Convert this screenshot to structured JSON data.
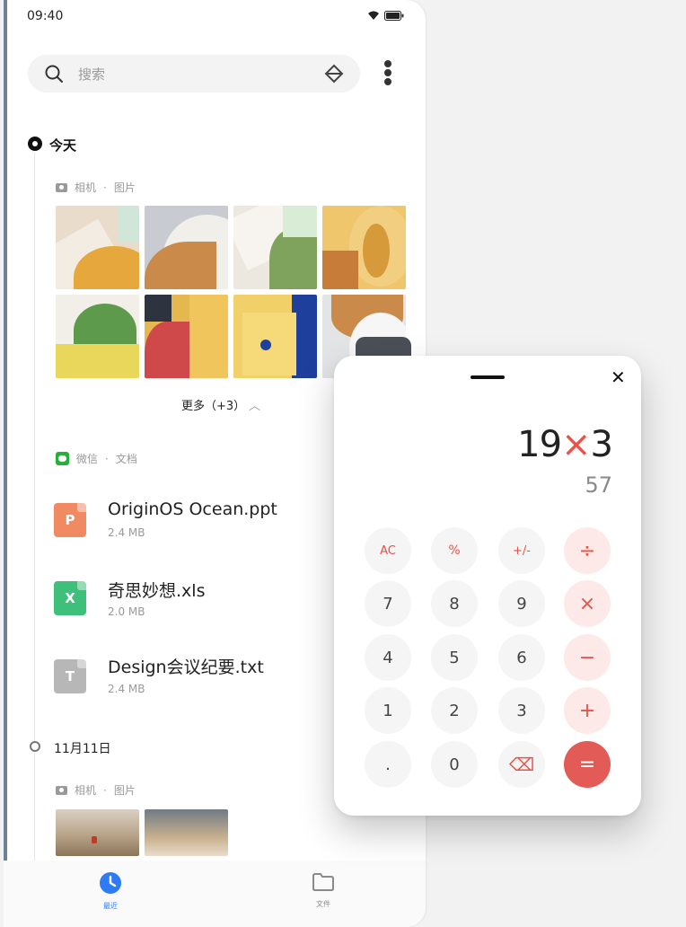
{
  "status": {
    "time": "09:40"
  },
  "search": {
    "placeholder": "搜索"
  },
  "today": {
    "title": "今天",
    "photos_source": {
      "app": "相机",
      "type": "图片"
    },
    "more": "更多（+3）",
    "docs_source": {
      "app": "微信",
      "type": "文档"
    },
    "files": [
      {
        "name": "OriginOS  Ocean.ppt",
        "size": "2.4 MB",
        "icon_letter": "P",
        "color": "#f08a63"
      },
      {
        "name": "奇思妙想.xls",
        "size": "2.0 MB",
        "icon_letter": "X",
        "color": "#3ec07a"
      },
      {
        "name": "Design会议纪要.txt",
        "size": "2.4 MB",
        "icon_letter": "T",
        "color": "#b7b7b7"
      }
    ]
  },
  "section2": {
    "title": "11月11日",
    "photos_source": {
      "app": "相机",
      "type": "图片"
    }
  },
  "tabs": [
    {
      "label": "最近",
      "active": true
    },
    {
      "label": "文件",
      "active": false
    }
  ],
  "calculator": {
    "expression_left": "19",
    "expression_op": "×",
    "expression_right": "3",
    "result": "57",
    "keys": [
      [
        "AC",
        "%",
        "+/-",
        "÷"
      ],
      [
        "7",
        "8",
        "9",
        "×"
      ],
      [
        "4",
        "5",
        "6",
        "−"
      ],
      [
        "1",
        "2",
        "3",
        "+"
      ],
      [
        ".",
        "0",
        "⌫",
        "="
      ]
    ],
    "accent": "#e35b57"
  }
}
